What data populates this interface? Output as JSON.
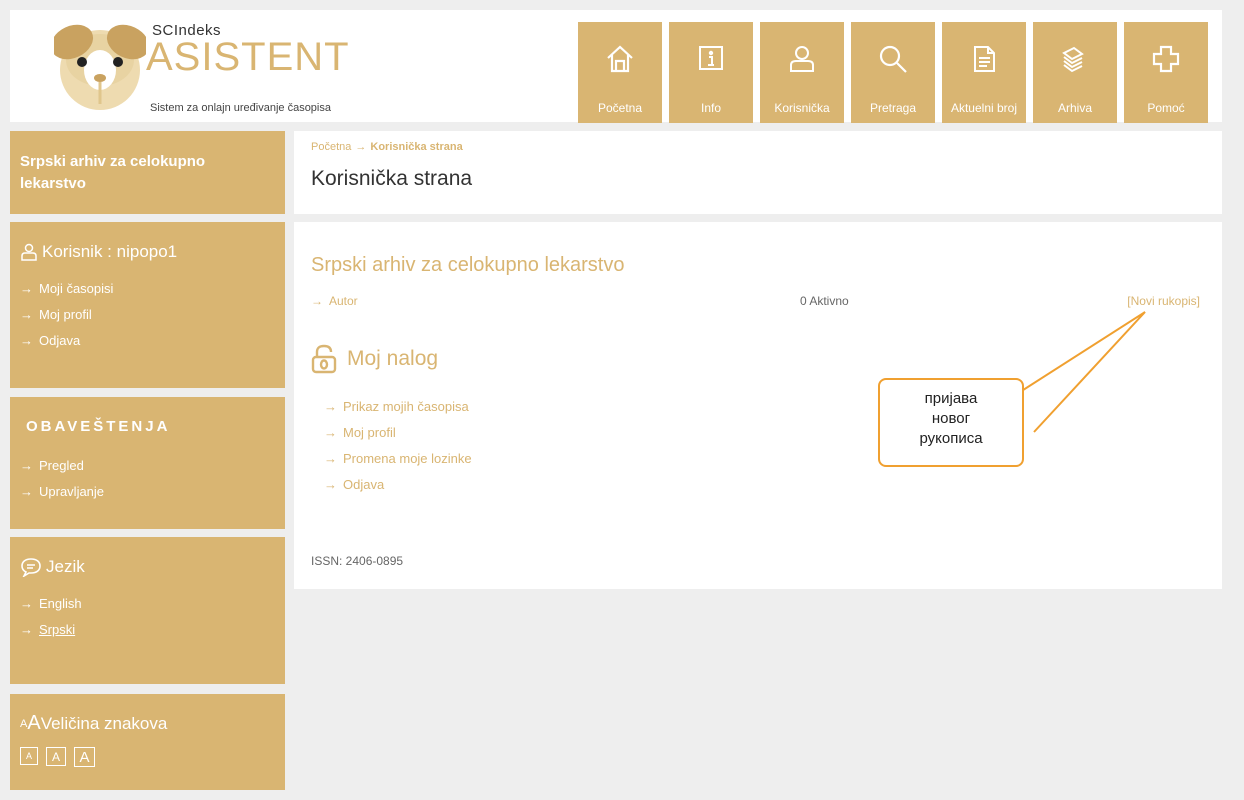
{
  "header": {
    "logo_sc": "SCIndeks",
    "logo_main": "ASISTENT",
    "logo_tagline": "Sistem za onlajn uređivanje časopisa",
    "nav": [
      {
        "label": "Početna",
        "icon": "home-icon"
      },
      {
        "label": "Info",
        "icon": "info-icon"
      },
      {
        "label": "Korisnička",
        "icon": "user-icon"
      },
      {
        "label": "Pretraga",
        "icon": "search-icon"
      },
      {
        "label": "Aktuelni broj",
        "icon": "document-icon"
      },
      {
        "label": "Arhiva",
        "icon": "archive-icon"
      },
      {
        "label": "Pomoć",
        "icon": "help-cross-icon"
      }
    ]
  },
  "sidebar": {
    "journal": "Srpski arhiv za celokupno lekarstvo",
    "user": {
      "title": "Korisnik : nipopo1",
      "links": [
        "Moji časopisi",
        "Moj profil",
        "Odjava"
      ]
    },
    "notifications": {
      "title": "OBAVEŠTENJA",
      "links": [
        "Pregled",
        "Upravljanje"
      ]
    },
    "language": {
      "title": "Jezik",
      "links": [
        "English",
        "Srpski"
      ]
    },
    "font_size": {
      "title": "Veličina znakova",
      "prefix_small": "A",
      "prefix_large": "A",
      "buttons": [
        "A",
        "A",
        "A"
      ]
    }
  },
  "breadcrumb": {
    "home": "Početna",
    "current": "Korisnička strana"
  },
  "page_title": "Korisnička strana",
  "main": {
    "journal_title": "Srpski arhiv za celokupno lekarstvo",
    "role": "Autor",
    "active": "0 Aktivno",
    "new_manuscript": "[Novi rukopis]",
    "account_title": "Moj nalog",
    "account_links": [
      "Prikaz mojih časopisa",
      "Moj profil",
      "Promena moje lozinke",
      "Odjava"
    ],
    "issn": "ISSN: 2406-0895"
  },
  "callout": {
    "lines": [
      "пријава",
      "новог",
      "рукописа"
    ]
  },
  "colors": {
    "accent": "#d9b572",
    "callout_border": "#f0a030"
  }
}
